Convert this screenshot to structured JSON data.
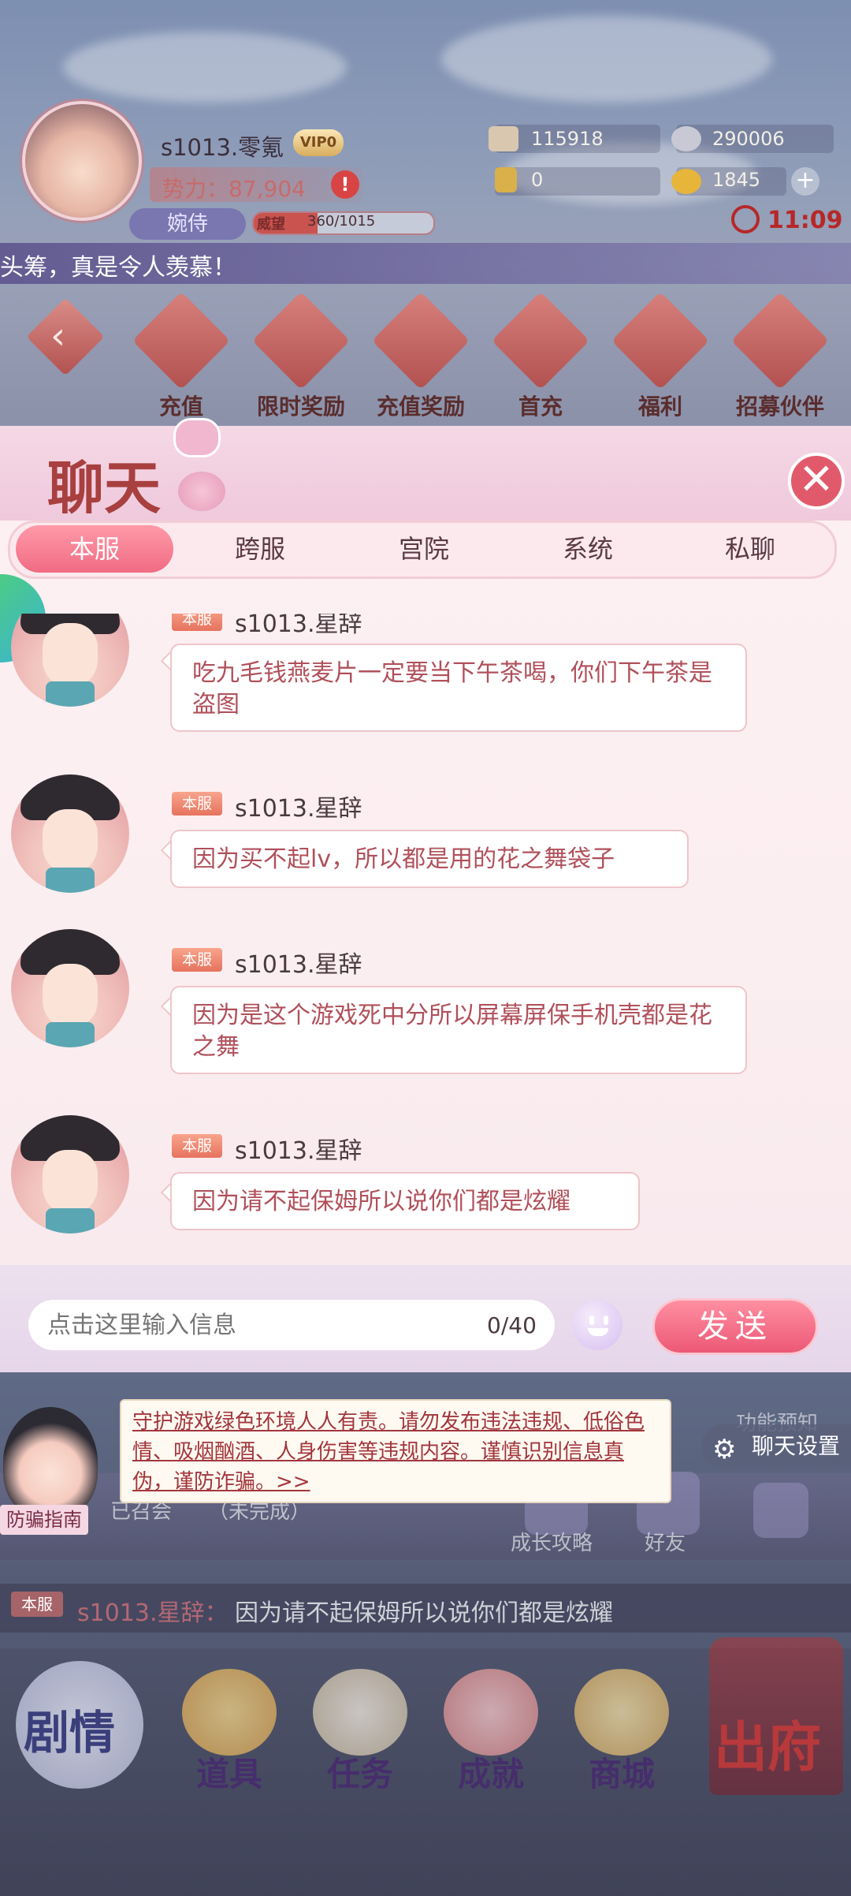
{
  "player": {
    "name": "s1013.零氪",
    "vip": "VIP0",
    "power": "势力：87,904",
    "rank": "婉侍",
    "prestige_label": "威望",
    "prestige_value": "360/1015",
    "prestige_fraction": 0.355
  },
  "resources": {
    "r1": "115918",
    "r2": "290006",
    "r3": "0",
    "r4": "1845",
    "plus": "+"
  },
  "clock": "11:09",
  "marquee": "头筹，真是令人羡慕！",
  "functions": [
    "充值",
    "限时奖励",
    "充值奖励",
    "首充",
    "福利",
    "招募伙伴"
  ],
  "chat": {
    "title": "聊天",
    "close": "✕",
    "tabs": [
      "本服",
      "跨服",
      "宫院",
      "系统",
      "私聊"
    ],
    "active_tab": 0,
    "messages": [
      {
        "tag": "本服",
        "sender": "s1013.星辞",
        "text": "吃九毛钱燕麦片一定要当下午茶喝，你们下午茶是盗图"
      },
      {
        "tag": "本服",
        "sender": "s1013.星辞",
        "text": "因为买不起lv，所以都是用的花之舞袋子"
      },
      {
        "tag": "本服",
        "sender": "s1013.星辞",
        "text": "因为是这个游戏死中分所以屏幕屏保手机壳都是花之舞"
      },
      {
        "tag": "本服",
        "sender": "s1013.星辞",
        "text": "因为请不起保姆所以说你们都是炫耀"
      }
    ],
    "input_placeholder": "点击这里输入信息",
    "char_count": "0/40",
    "send_label": "发送"
  },
  "notice": {
    "text": "守护游戏绿色环境人人有责。请勿发布违法违规、低俗色情、吸烟酗酒、人身伤害等违规内容。谨慎识别信息真伪，谨防诈骗。>>",
    "mascot_label": "防骗指南",
    "settings_label": "聊天设置",
    "preview_label": "功能预知"
  },
  "dim_row": {
    "left_text": "已召会",
    "status": "（未完成）",
    "guide": "成长攻略",
    "friends": "好友"
  },
  "ticker": {
    "tag": "本服",
    "sender": "s1013.星辞：",
    "text": "因为请不起保姆所以说你们都是炫耀"
  },
  "bottom_nav": {
    "story": "剧情",
    "items": [
      "道具",
      "任务",
      "成就",
      "商城"
    ],
    "leave": "出府"
  },
  "colors": {
    "accent": "#f06b83",
    "chat_text": "#b0505a",
    "clock": "#b62828"
  }
}
